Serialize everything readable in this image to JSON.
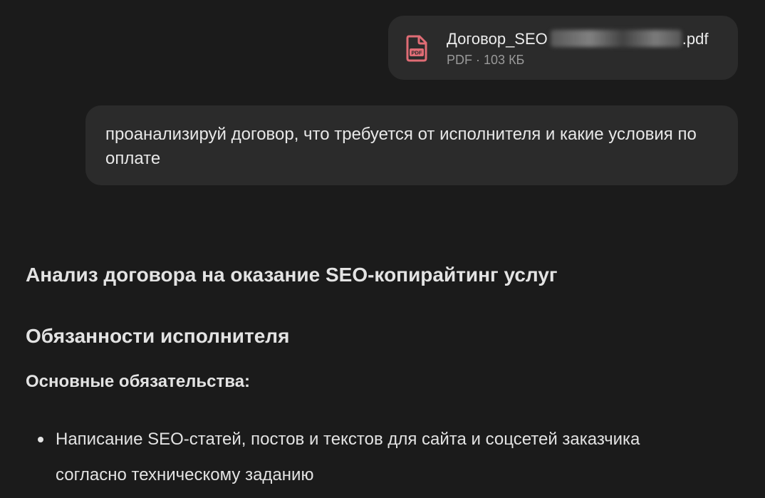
{
  "attachment": {
    "name_prefix": "Договор_SEO",
    "name_suffix": ".pdf",
    "type": "PDF",
    "separator": "·",
    "size": "103 КБ",
    "icon": "pdf-file-icon",
    "icon_color": "#e06c75"
  },
  "user_message": {
    "text": "проанализируй договор, что требуется от исполнителя и какие условия по оплате"
  },
  "answer": {
    "title": "Анализ договора на оказание SEO-копирайтинг услуг",
    "section_title": "Обязанности исполнителя",
    "subsection_title": "Основные обязательства:",
    "items": [
      "Написание SEO-статей, постов и текстов для сайта и соцсетей заказчика согласно техническому заданию"
    ]
  },
  "colors": {
    "background": "#1b1b1b",
    "bubble": "#2b2b2b",
    "text": "#e3e3e3",
    "muted": "#9a9a9a"
  }
}
